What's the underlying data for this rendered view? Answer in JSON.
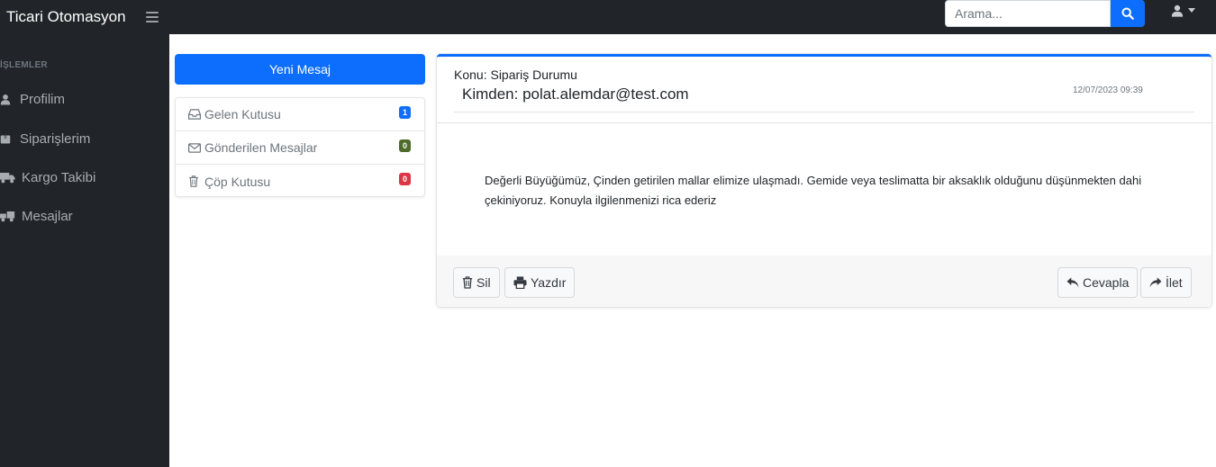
{
  "app": {
    "title": "Ticari Otomasyon"
  },
  "search": {
    "placeholder": "Arama..."
  },
  "sidebar": {
    "heading": "İŞLEMLER",
    "items": [
      {
        "label": "Profilim",
        "icon": "user-icon"
      },
      {
        "label": "Siparişlerim",
        "icon": "box-icon"
      },
      {
        "label": "Kargo Takibi",
        "icon": "truck-icon"
      },
      {
        "label": "Mesajlar",
        "icon": "truck-loading-icon"
      }
    ]
  },
  "mailbox": {
    "new_message_label": "Yeni Mesaj",
    "folders": [
      {
        "label": "Gelen Kutusu",
        "count": "1",
        "badge_color": "#0d6efd",
        "icon": "inbox-icon"
      },
      {
        "label": "Gönderilen Mesajlar",
        "count": "0",
        "badge_color": "#4e6b2c",
        "icon": "envelope-icon"
      },
      {
        "label": "Çöp Kutusu",
        "count": "0",
        "badge_color": "#dc3545",
        "icon": "trash-icon"
      }
    ]
  },
  "message": {
    "subject": "Konu: Sipariş Durumu",
    "from": "Kimden: polat.alemdar@test.com",
    "date": "12/07/2023 09:39",
    "body": "Değerli Büyüğümüz, Çinden getirilen mallar elimize ulaşmadı. Gemide veya teslimatta bir aksaklık olduğunu düşünmekten dahi çekiniyoruz. Konuyla ilgilenmenizi rica ederiz"
  },
  "actions": {
    "delete_label": "Sil",
    "print_label": "Yazdır",
    "reply_label": "Cevapla",
    "forward_label": "İlet"
  },
  "colors": {
    "primary": "#0d6efd",
    "dark": "#212529",
    "sidebar_text": "#a7acb1"
  }
}
